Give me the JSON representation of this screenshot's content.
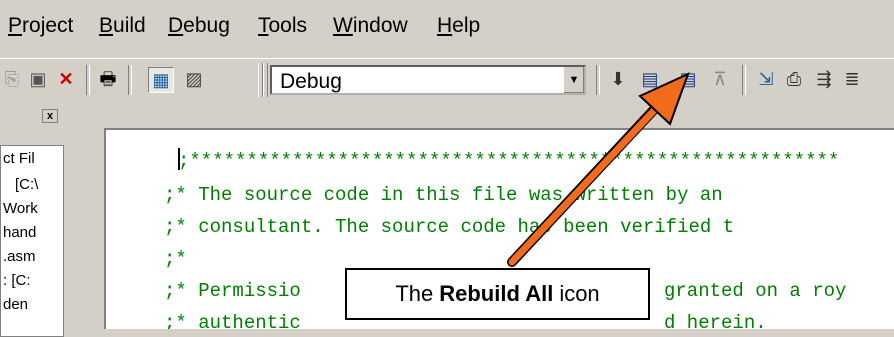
{
  "menu": {
    "items": [
      {
        "label": "Project"
      },
      {
        "label": "Build"
      },
      {
        "label": "Debug"
      },
      {
        "label": "Tools"
      },
      {
        "label": "Window"
      },
      {
        "label": "Help"
      }
    ]
  },
  "toolbar": {
    "config_combo": {
      "value": "Debug"
    }
  },
  "left_panel": {
    "lines": [
      "ct Fil",
      "[C:\\",
      "Work",
      "hand",
      ".asm",
      ": [C:",
      "den"
    ]
  },
  "editor": {
    "lines": [
      ";*********************************************************",
      ";* The source code in this file was written by an",
      ";* consultant. The source code has been verified t",
      ";*",
      ";* Permissio",
      ";* authentic"
    ],
    "line5_suffix": "granted on a roy",
    "line6_suffix": "d herein."
  },
  "callout": {
    "prefix": "The",
    "bold": "Rebuild All",
    "suffix": "icon"
  },
  "colors": {
    "code_green": "#008000",
    "arrow_orange": "#f26a1b",
    "chrome": "#d4d0c8"
  }
}
